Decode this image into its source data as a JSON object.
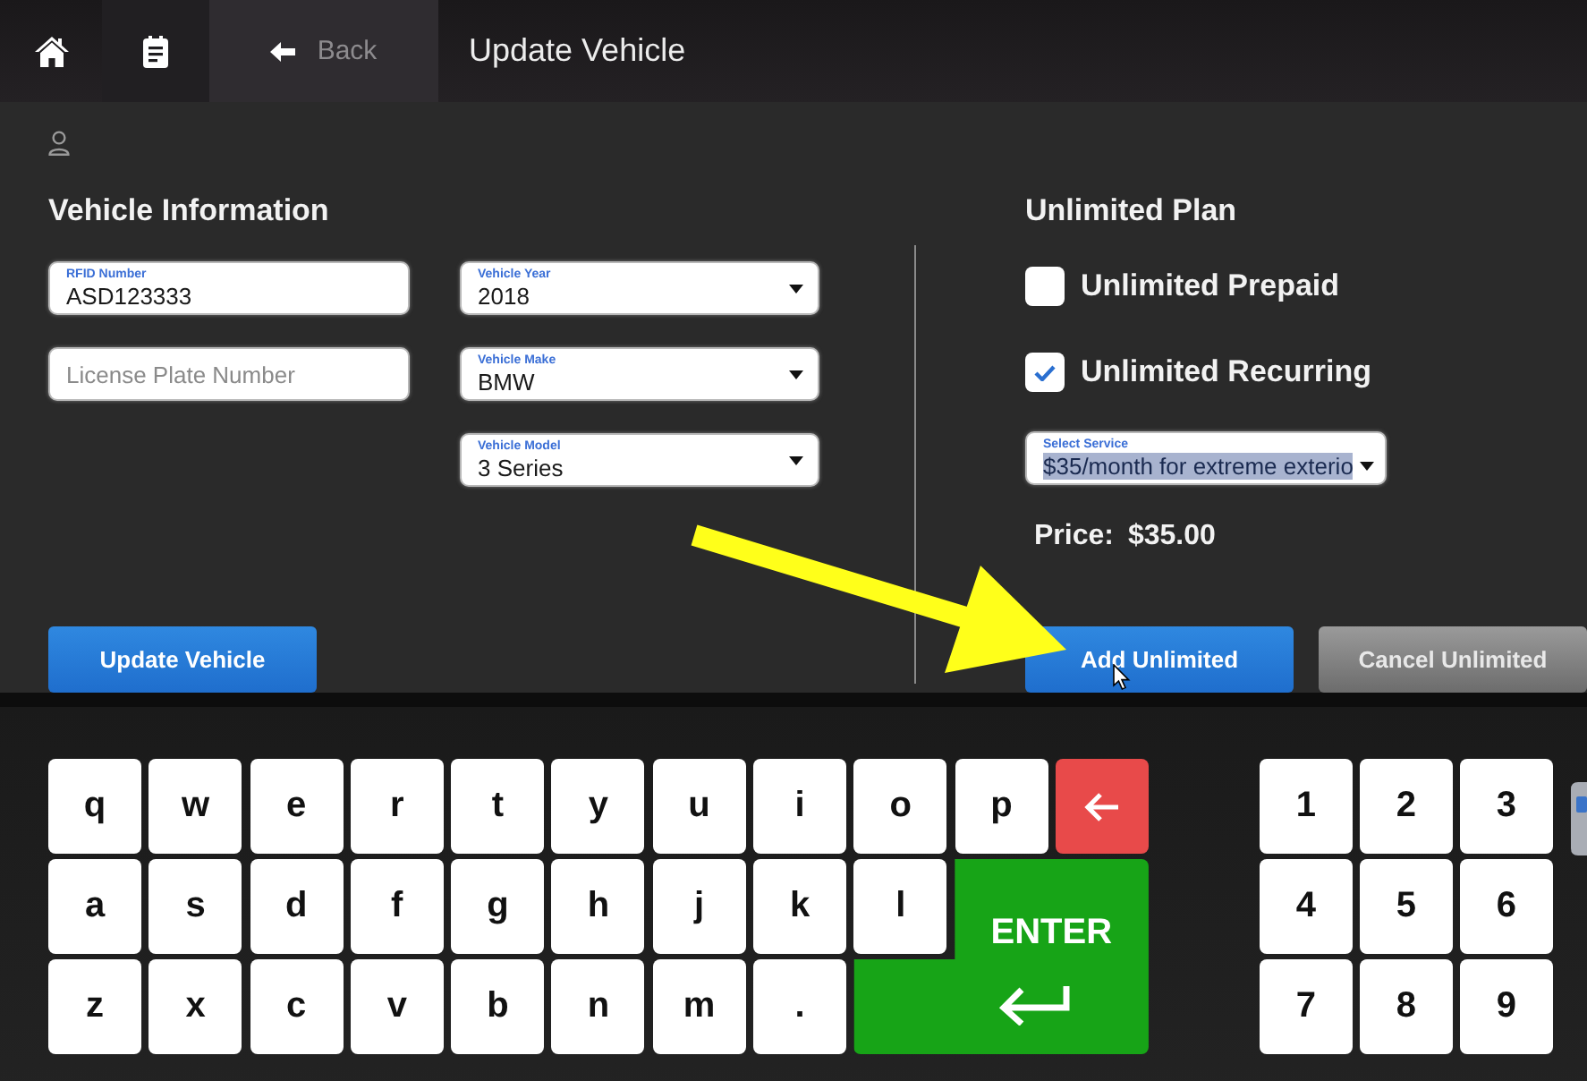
{
  "top_bar": {
    "back": "Back",
    "title": "Update Vehicle"
  },
  "vehicle_info": {
    "heading": "Vehicle Information",
    "text_fields": [
      {
        "label": "RFID Number",
        "value": "ASD123333"
      },
      {
        "placeholder": "License Plate Number"
      }
    ],
    "dropdowns": [
      {
        "label": "Vehicle Year",
        "value": "2018"
      },
      {
        "label": "Vehicle Make",
        "value": "BMW"
      },
      {
        "label": "Vehicle Model",
        "value": "3 Series"
      }
    ],
    "button": {
      "label": "Update Vehicle",
      "kind": "primary"
    }
  },
  "unlimited_plan": {
    "heading": "Unlimited Plan",
    "options": [
      {
        "label": "Unlimited Prepaid",
        "checked": false
      },
      {
        "label": "Unlimited Recurring",
        "checked": true
      }
    ],
    "service": {
      "label": "Select Service",
      "value": "$35/month for extreme exterio",
      "highlighted": true
    },
    "price_label": "Price:",
    "price": "$35.00",
    "buttons": [
      {
        "label": "Add Unlimited",
        "kind": "primary"
      },
      {
        "label": "Cancel Unlimited",
        "kind": "secondary"
      }
    ]
  },
  "keyboard": {
    "rows": [
      [
        {
          "kind": "char",
          "label": "q"
        },
        {
          "kind": "char",
          "label": "w"
        },
        {
          "kind": "char",
          "label": "e"
        },
        {
          "kind": "char",
          "label": "r"
        },
        {
          "kind": "char",
          "label": "t"
        },
        {
          "kind": "char",
          "label": "y"
        },
        {
          "kind": "char",
          "label": "u"
        },
        {
          "kind": "char",
          "label": "i"
        },
        {
          "kind": "char",
          "label": "o"
        },
        {
          "kind": "char",
          "label": "p"
        },
        {
          "kind": "backspace"
        }
      ],
      [
        {
          "kind": "char",
          "label": "a"
        },
        {
          "kind": "char",
          "label": "s"
        },
        {
          "kind": "char",
          "label": "d"
        },
        {
          "kind": "char",
          "label": "f"
        },
        {
          "kind": "char",
          "label": "g"
        },
        {
          "kind": "char",
          "label": "h"
        },
        {
          "kind": "char",
          "label": "j"
        },
        {
          "kind": "char",
          "label": "k"
        },
        {
          "kind": "char",
          "label": "l"
        },
        {
          "kind": "enter",
          "label": "ENTER"
        }
      ],
      [
        {
          "kind": "char",
          "label": "z"
        },
        {
          "kind": "char",
          "label": "x"
        },
        {
          "kind": "char",
          "label": "c"
        },
        {
          "kind": "char",
          "label": "v"
        },
        {
          "kind": "char",
          "label": "b"
        },
        {
          "kind": "char",
          "label": "n"
        },
        {
          "kind": "char",
          "label": "m"
        },
        {
          "kind": "char",
          "label": "."
        }
      ]
    ],
    "numpad": [
      "1",
      "2",
      "3",
      "4",
      "5",
      "6",
      "7",
      "8",
      "9"
    ]
  }
}
